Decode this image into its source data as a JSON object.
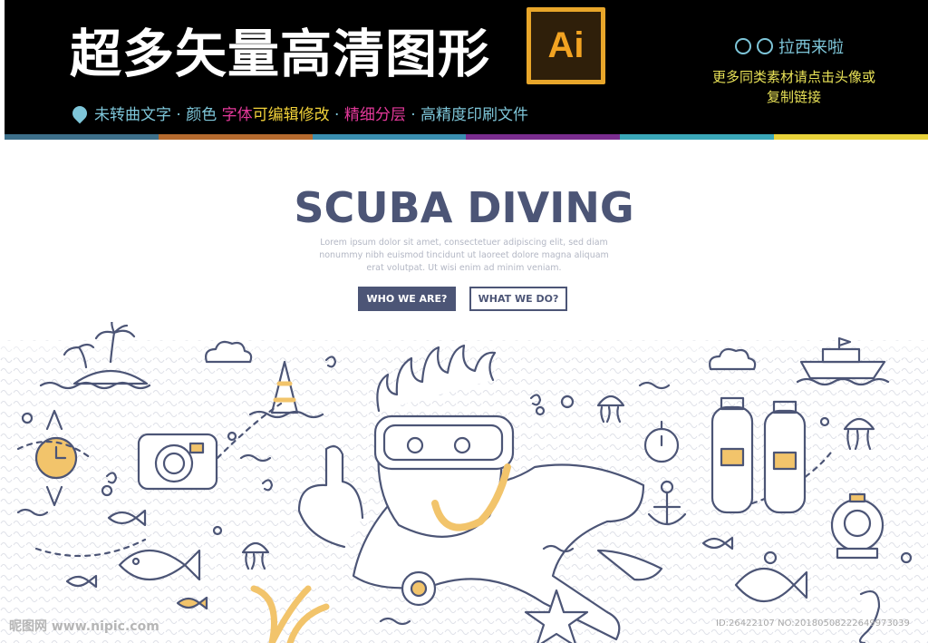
{
  "banner": {
    "title": "超多矢量高清图形",
    "logo_text": "Ai",
    "author": "拉西来啦",
    "author_note": "更多同类素材请点击头像或复制链接",
    "features": [
      {
        "text": "未转曲文字",
        "color": "cyan"
      },
      {
        "text": " · 颜色 ",
        "color": "cyan"
      },
      {
        "text": "字体",
        "color": "pink"
      },
      {
        "text": "可编辑修改",
        "color": "yellow"
      },
      {
        "text": " · ",
        "color": "cyan"
      },
      {
        "text": "精细分层",
        "color": "pink"
      },
      {
        "text": " · 高精度印刷文件",
        "color": "cyan"
      }
    ],
    "bar_colors": [
      "#3d6f8a",
      "#b56a2e",
      "#3a8fb0",
      "#7a2d8f",
      "#3aa7b8",
      "#e8d23a"
    ]
  },
  "hero": {
    "title": "SCUBA DIVING",
    "text": "Lorem ipsum dolor sit amet, consectetuer adipiscing elit, sed diam nonummy nibh euismod tincidunt ut laoreet dolore magna aliquam erat volutpat. Ut wisi enim ad minim veniam.",
    "button_primary": "WHO WE ARE?",
    "button_secondary": "WHAT WE DO?"
  },
  "watermark": {
    "site": "昵图网 www.nipic.com",
    "id": "ID:26422107 NO:20180508222649973039"
  },
  "colors": {
    "navy": "#4c5576",
    "accent_yellow": "#f2c46b",
    "banner_bg": "#000000"
  }
}
